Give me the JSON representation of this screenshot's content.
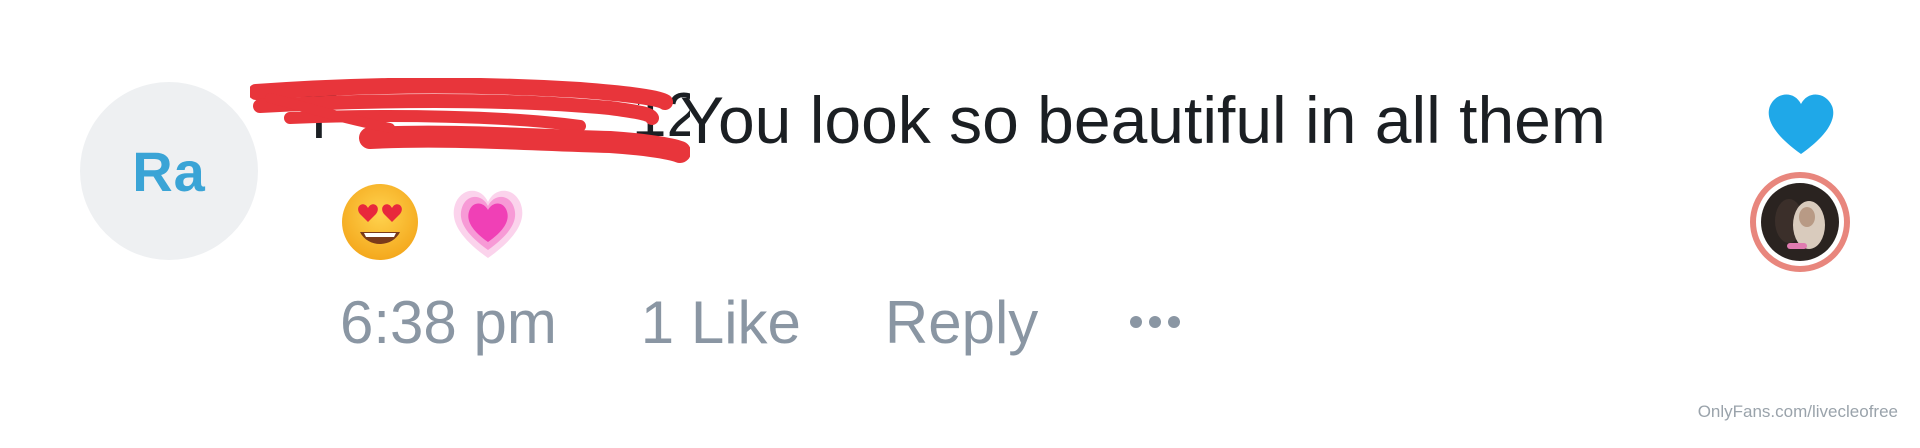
{
  "comment": {
    "author_initials": "Ra",
    "author_name_visible_fragment": "12",
    "text": "You look so beautiful in all them",
    "emojis": [
      "heart-eyes-emoji",
      "growing-heart-emoji"
    ],
    "time": "6:38 pm",
    "likes": "1 Like",
    "reply_label": "Reply",
    "more_label": "…",
    "liked": true
  },
  "colors": {
    "avatar_bg": "#eef0f2",
    "avatar_text": "#3aa4d6",
    "heart_liked": "#1fa8e8",
    "meta_text": "#8a96a3",
    "redaction": "#e8353b",
    "liker_ring": "#e8867d"
  },
  "icons": {
    "like": "heart-icon",
    "more": "more-dots-icon"
  },
  "watermark": "OnlyFans.com/livecleofree"
}
